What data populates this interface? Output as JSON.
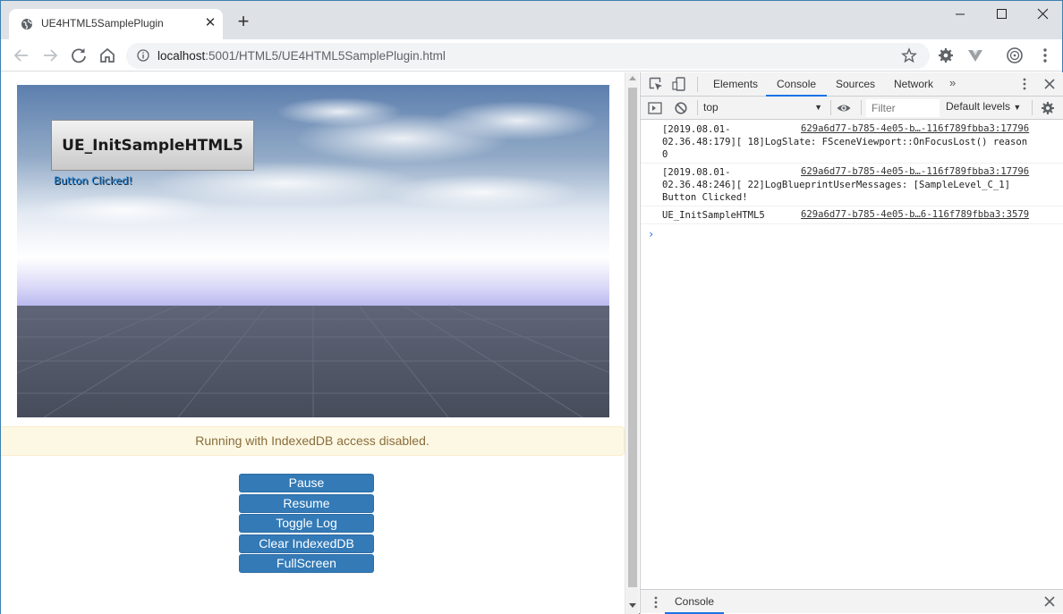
{
  "browser": {
    "tab_title": "UE4HTML5SamplePlugin",
    "url_host": "localhost",
    "url_rest": ":5001/HTML5/UE4HTML5SamplePlugin.html"
  },
  "game": {
    "button_label": "UE_InitSampleHTML5",
    "clicked_text": "Button Clicked!"
  },
  "page": {
    "status": "Running with IndexedDB access disabled.",
    "controls": [
      "Pause",
      "Resume",
      "Toggle Log",
      "Clear IndexedDB",
      "FullScreen"
    ]
  },
  "devtools": {
    "tabs": {
      "elements": "Elements",
      "console": "Console",
      "sources": "Sources",
      "network": "Network",
      "more": "»"
    },
    "context": "top",
    "filter_placeholder": "Filter",
    "levels": "Default levels",
    "messages": [
      {
        "text": "[2019.08.01-\n02.36.48:179][ 18]LogSlate: FSceneViewport::OnFocusLost() reason\n0",
        "source": "629a6d77-b785-4e05-b…-116f789fbba3:17796"
      },
      {
        "text": "[2019.08.01-\n02.36.48:246][ 22]LogBlueprintUserMessages: [SampleLevel_C_1]\nButton Clicked!",
        "source": "629a6d77-b785-4e05-b…-116f789fbba3:17796"
      },
      {
        "text": "UE_InitSampleHTML5",
        "source": "629a6d77-b785-4e05-b…6-116f789fbba3:3579"
      }
    ],
    "prompt": "›",
    "drawer_tab": "Console"
  },
  "icons": {
    "tab_favicon": "globe-icon",
    "back": "arrow-left-icon",
    "forward": "arrow-right-icon",
    "reload": "reload-icon",
    "home": "home-icon",
    "info": "info-icon",
    "bookmark": "star-icon"
  },
  "colors": {
    "accent": "#1a73e8",
    "button_primary": "#337ab7",
    "warning_bg": "#fcf8e3",
    "warning_text": "#8a6d3b"
  }
}
